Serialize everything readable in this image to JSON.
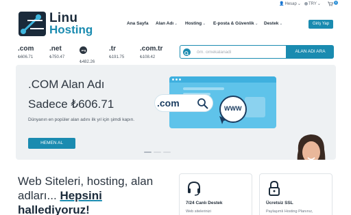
{
  "topbar": {
    "account": "Hesap",
    "currency": "TRY",
    "cart_count": "0"
  },
  "logo": {
    "line1": "Linu",
    "line2": "Hosting"
  },
  "nav": {
    "items": [
      "Ana Sayfa",
      "Alan Adı",
      "Hosting",
      "E-posta & Güvenlik",
      "Destek"
    ],
    "login": "Giriş Yap"
  },
  "domains": [
    {
      "ext": ".com",
      "price": "₺606.71"
    },
    {
      "ext": ".net",
      "price": "₺750.47"
    },
    {
      "ext": ".org",
      "price": "₺482.26"
    },
    {
      "ext": ".tr",
      "price": "₺191.75"
    },
    {
      "ext": ".com.tr",
      "price": "₺108.42"
    }
  ],
  "search": {
    "placeholder": "örn. ornekalanadi",
    "button": "ALAN ADI ARA"
  },
  "hero": {
    "title_line1": ".COM Alan Adı",
    "title_line2": "Sadece ₺606.71",
    "subtitle": "Dünyanın en popüler alan adını ilk yıl için şimdi kapın.",
    "button": "HEMEN AL",
    "illustration_domain": ".com",
    "illustration_www": "WWW"
  },
  "headline": {
    "part1": "Web Siteleri, hosting, alan",
    "part2": "adları...",
    "part3": "Hepsini",
    "part4": "hallediyoruz!"
  },
  "cards": [
    {
      "title": "7/24 Canlı Destek",
      "text": "Web sitelerinizi",
      "icon": "headset-icon"
    },
    {
      "title": "Ücretsiz SSL",
      "text": "Paylaşımlı Hosting Planınız,",
      "icon": "lock-icon"
    }
  ],
  "colors": {
    "primary": "#1a8bb0",
    "dark": "#1a2a3a",
    "hero_bg": "#eef1f3"
  }
}
